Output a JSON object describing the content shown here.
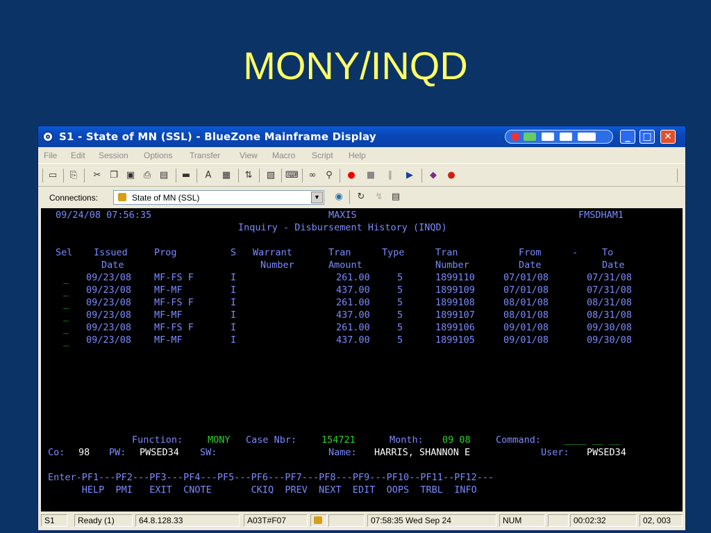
{
  "slide": {
    "title": "MONY/INQD"
  },
  "window": {
    "title": "S1 - State of MN (SSL) - BlueZone Mainframe Display",
    "menu": [
      "File",
      "Edit",
      "Session",
      "Options",
      "Transfer",
      "View",
      "Macro",
      "Script",
      "Help"
    ],
    "connections_label": "Connections:",
    "connection_value": "State of MN (SSL)"
  },
  "terminal": {
    "header": {
      "datetime": "09/24/08 07:56:35",
      "system": "MAXIS",
      "user_id": "FMSDHAM1",
      "screen_title": "Inquiry - Disbursement History (INQD)"
    },
    "col_headers": {
      "line1": [
        "Sel",
        "Issued",
        "Prog",
        "S",
        "Warrant",
        "Tran",
        "Type",
        "Tran",
        "From",
        "-",
        "To"
      ],
      "line2": [
        "Date",
        "Number",
        "Amount",
        "Number",
        "Date",
        "Date"
      ]
    },
    "rows": [
      {
        "sel": "_",
        "issued": "09/23/08",
        "prog": "MF-FS F",
        "s": "I",
        "warrant": "",
        "amount": "261.00",
        "type": "5",
        "tran_nbr": "1899110",
        "from": "07/01/08",
        "to": "07/31/08"
      },
      {
        "sel": "_",
        "issued": "09/23/08",
        "prog": "MF-MF",
        "s": "I",
        "warrant": "",
        "amount": "437.00",
        "type": "5",
        "tran_nbr": "1899109",
        "from": "07/01/08",
        "to": "07/31/08"
      },
      {
        "sel": "_",
        "issued": "09/23/08",
        "prog": "MF-FS F",
        "s": "I",
        "warrant": "",
        "amount": "261.00",
        "type": "5",
        "tran_nbr": "1899108",
        "from": "08/01/08",
        "to": "08/31/08"
      },
      {
        "sel": "_",
        "issued": "09/23/08",
        "prog": "MF-MF",
        "s": "I",
        "warrant": "",
        "amount": "437.00",
        "type": "5",
        "tran_nbr": "1899107",
        "from": "08/01/08",
        "to": "08/31/08"
      },
      {
        "sel": "_",
        "issued": "09/23/08",
        "prog": "MF-FS F",
        "s": "I",
        "warrant": "",
        "amount": "261.00",
        "type": "5",
        "tran_nbr": "1899106",
        "from": "09/01/08",
        "to": "09/30/08"
      },
      {
        "sel": "_",
        "issued": "09/23/08",
        "prog": "MF-MF",
        "s": "I",
        "warrant": "",
        "amount": "437.00",
        "type": "5",
        "tran_nbr": "1899105",
        "from": "09/01/08",
        "to": "09/30/08"
      }
    ],
    "footer": {
      "function_label": "Function:",
      "function_value": "MONY",
      "case_label": "Case Nbr:",
      "case_value": "154721",
      "month_label": "Month:",
      "month_value": "09 08",
      "command_label": "Command:",
      "command_value": "____ __ __",
      "co_label": "Co:",
      "co_value": "98",
      "pw_label": "PW:",
      "pw_value": "PWSED34",
      "sw_label": "SW:",
      "name_label": "Name:",
      "name_value": "HARRIS, SHANNON E",
      "user_label": "User:",
      "user_value": "PWSED34"
    },
    "pf_line1": "Enter-PF1---PF2---PF3---PF4---PF5---PF6---PF7---PF8---PF9---PF10--PF11--PF12---",
    "pf_line2": "      HELP  PMI   EXIT  CNOTE       CKIQ  PREV  NEXT  EDIT  OOPS  TRBL  INFO"
  },
  "statusbar": {
    "session": "S1",
    "state": "Ready (1)",
    "ip": "64.8.128.33",
    "terminal_id": "A03T#F07",
    "clock": "07:58:35 Wed Sep 24",
    "numlock": "NUM",
    "elapsed": "00:02:32",
    "cursor": "02, 003"
  },
  "colors": {
    "background": "#0c3366",
    "slide_title": "#ffff66",
    "term_blue": "#7a8cff",
    "term_green": "#2dd12d",
    "term_white": "#ffffff"
  }
}
